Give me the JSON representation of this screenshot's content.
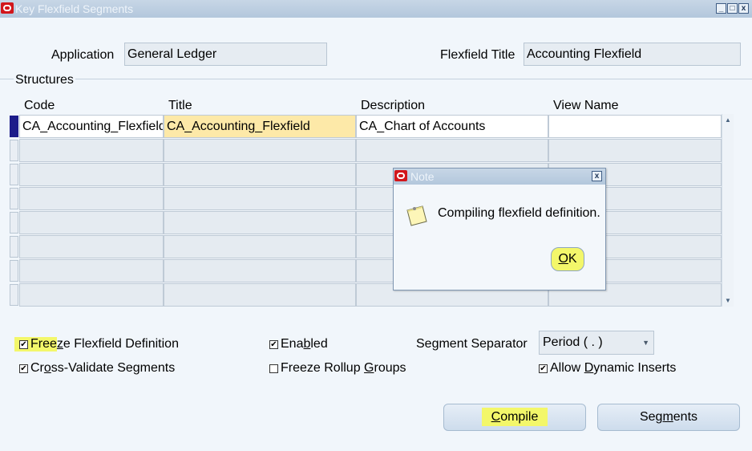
{
  "window": {
    "title": "Key Flexfield Segments",
    "controls": {
      "minimize": "_",
      "maximize": "□",
      "close": "x"
    }
  },
  "header": {
    "application_label": "Application",
    "application_value": "General Ledger",
    "flexfield_title_label": "Flexfield Title",
    "flexfield_title_value": "Accounting Flexfield"
  },
  "structures": {
    "section_label": "Structures",
    "columns": [
      "Code",
      "Title",
      "Description",
      "View Name"
    ],
    "rows": [
      {
        "code": "CA_Accounting_Flexfield",
        "title": "CA_Accounting_Flexfield",
        "description": "CA_Chart of Accounts",
        "view_name": ""
      },
      {
        "code": "",
        "title": "",
        "description": "",
        "view_name": ""
      },
      {
        "code": "",
        "title": "",
        "description": "",
        "view_name": ""
      },
      {
        "code": "",
        "title": "",
        "description": "",
        "view_name": ""
      },
      {
        "code": "",
        "title": "",
        "description": "",
        "view_name": ""
      },
      {
        "code": "",
        "title": "",
        "description": "",
        "view_name": ""
      },
      {
        "code": "",
        "title": "",
        "description": "",
        "view_name": ""
      },
      {
        "code": "",
        "title": "",
        "description": "",
        "view_name": ""
      }
    ]
  },
  "options": {
    "freeze_definition": {
      "pre": "Free",
      "key": "z",
      "post": "e Flexfield Definition",
      "checked": true
    },
    "cross_validate": {
      "pre": "Cr",
      "key": "o",
      "post": "ss-Validate Segments",
      "checked": true
    },
    "enabled": {
      "pre": "Ena",
      "key": "b",
      "post": "led",
      "checked": true
    },
    "freeze_rollup": {
      "pre": "Freeze Rollup ",
      "key": "G",
      "post": "roups",
      "checked": false
    },
    "allow_dynamic": {
      "pre": "Allow ",
      "key": "D",
      "post": "ynamic Inserts",
      "checked": true
    },
    "segment_separator_label": "Segment Separator",
    "segment_separator_value": "Period ( . )"
  },
  "buttons": {
    "compile": {
      "key": "C",
      "rest": "ompile"
    },
    "segments": {
      "pre": "Seg",
      "key": "m",
      "post": "ents"
    }
  },
  "dialog": {
    "title": "Note",
    "message": "Compiling flexfield definition.",
    "ok": {
      "key": "O",
      "rest": "K"
    }
  },
  "colors": {
    "highlight": "#f3f76a",
    "title_cell": "#fde9a8",
    "record_indicator": "#1c1c8a"
  }
}
